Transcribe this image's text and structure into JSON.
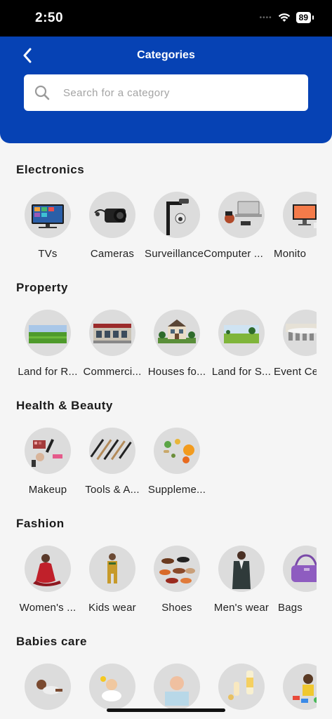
{
  "status_bar": {
    "time": "2:50",
    "signal": "••••",
    "battery": "89"
  },
  "header": {
    "title": "Categories",
    "search_placeholder": "Search for a category"
  },
  "sections": [
    {
      "title": "Electronics",
      "items": [
        {
          "label": "TVs",
          "icon": "tv-icon"
        },
        {
          "label": "Cameras",
          "icon": "camera-icon"
        },
        {
          "label": "SurveillanceComputer ...",
          "icon": "surveillance-camera-icon",
          "label_only_first": true
        },
        {
          "label": "",
          "icon": "laptop-icon"
        },
        {
          "label": "Monito",
          "icon": "monitor-icon"
        }
      ]
    },
    {
      "title": "Property",
      "items": [
        {
          "label": "Land for R...",
          "icon": "land-icon"
        },
        {
          "label": "Commerci...",
          "icon": "commercial-building-icon"
        },
        {
          "label": "Houses fo...",
          "icon": "house-icon"
        },
        {
          "label": "Land for S...",
          "icon": "land-field-icon"
        },
        {
          "label": "Event Ce",
          "icon": "event-centre-icon"
        }
      ]
    },
    {
      "title": "Health & Beauty",
      "items": [
        {
          "label": "Makeup",
          "icon": "makeup-icon"
        },
        {
          "label": "Tools & A...",
          "icon": "beauty-tools-icon"
        },
        {
          "label": "Suppleme...",
          "icon": "supplements-icon"
        }
      ]
    },
    {
      "title": "Fashion",
      "items": [
        {
          "label": "Women's ...",
          "icon": "womens-wear-icon"
        },
        {
          "label": "Kids wear",
          "icon": "kids-wear-icon"
        },
        {
          "label": "Shoes",
          "icon": "shoes-icon"
        },
        {
          "label": "Men's wear",
          "icon": "mens-wear-icon"
        },
        {
          "label": "Bags",
          "icon": "bag-icon"
        }
      ]
    },
    {
      "title": "Babies care",
      "items": [
        {
          "label": "",
          "icon": "baby-icon"
        },
        {
          "label": "",
          "icon": "baby-bath-icon"
        },
        {
          "label": "",
          "icon": "baby-skincare-icon"
        },
        {
          "label": "",
          "icon": "baby-bottle-icon"
        },
        {
          "label": "",
          "icon": "baby-toys-icon"
        }
      ]
    }
  ],
  "colors": {
    "header": "#0642b4",
    "background": "#f5f5f5",
    "circle": "#dcdcdc"
  }
}
